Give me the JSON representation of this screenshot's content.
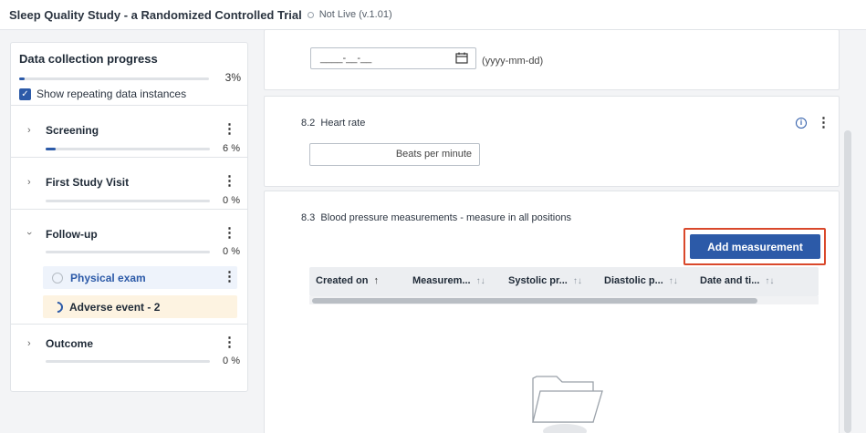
{
  "header": {
    "title": "Sleep Quality Study - a Randomized Controlled Trial",
    "status": "Not Live (v.1.01)"
  },
  "sidebar": {
    "title": "Data collection progress",
    "overall_percent": "3%",
    "overall_fraction": 0.03,
    "show_repeating_label": "Show repeating data instances",
    "show_repeating_checked": true,
    "groups": [
      {
        "name": "Screening",
        "percent": "6 %",
        "fraction": 0.06,
        "expanded": false
      },
      {
        "name": "First Study Visit",
        "percent": "0 %",
        "fraction": 0,
        "expanded": false
      },
      {
        "name": "Follow-up",
        "percent": "0 %",
        "fraction": 0,
        "expanded": true,
        "items": [
          {
            "name": "Physical exam",
            "state": "not-started"
          },
          {
            "name": "Adverse event - 2",
            "state": "in-progress"
          }
        ]
      },
      {
        "name": "Outcome",
        "percent": "0 %",
        "fraction": 0,
        "expanded": false
      }
    ]
  },
  "form": {
    "date_field": {
      "value": "____-__-__",
      "format_hint": "(yyyy-mm-dd)"
    },
    "heart_rate": {
      "number": "8.2",
      "label": "Heart rate",
      "placeholder": "Beats per minute"
    },
    "blood_pressure": {
      "number": "8.3",
      "label": "Blood pressure measurements - measure in all positions",
      "add_button": "Add measurement",
      "columns": [
        "Created on",
        "Measurem...",
        "Systolic pr...",
        "Diastolic p...",
        "Date and ti..."
      ]
    }
  },
  "colors": {
    "accent": "#2c5aa8",
    "highlight_border": "#d9482b",
    "active_item_bg": "#eef3fb",
    "progress_item_bg": "#fdf3e1"
  }
}
